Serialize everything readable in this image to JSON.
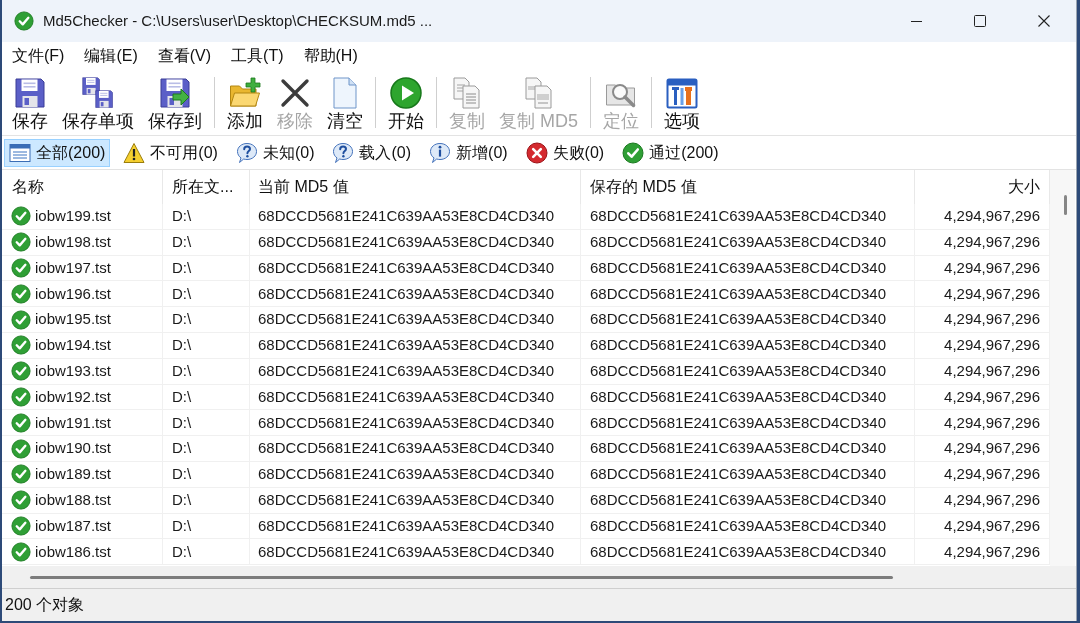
{
  "window": {
    "title": "Md5Checker - C:\\Users\\user\\Desktop\\CHECKSUM.md5 ..."
  },
  "menu": [
    "文件(F)",
    "编辑(E)",
    "查看(V)",
    "工具(T)",
    "帮助(H)"
  ],
  "toolbar": {
    "groups": [
      {
        "buttons": [
          {
            "label": "保存",
            "disabled": false
          },
          {
            "label": "保存单项",
            "disabled": false
          },
          {
            "label": "保存到",
            "disabled": false
          }
        ]
      },
      {
        "buttons": [
          {
            "label": "添加",
            "disabled": false
          },
          {
            "label": "移除",
            "disabled": true
          },
          {
            "label": "清空",
            "disabled": false
          }
        ]
      },
      {
        "buttons": [
          {
            "label": "开始",
            "disabled": false
          }
        ]
      },
      {
        "buttons": [
          {
            "label": "复制",
            "disabled": true
          },
          {
            "label": "复制 MD5",
            "disabled": true
          }
        ]
      },
      {
        "buttons": [
          {
            "label": "定位",
            "disabled": true
          }
        ]
      },
      {
        "buttons": [
          {
            "label": "选项",
            "disabled": false
          }
        ]
      }
    ]
  },
  "filters": [
    {
      "label": "全部(200)",
      "selected": true
    },
    {
      "label": "不可用(0)",
      "selected": false
    },
    {
      "label": "未知(0)",
      "selected": false
    },
    {
      "label": "载入(0)",
      "selected": false
    },
    {
      "label": "新增(0)",
      "selected": false
    },
    {
      "label": "失败(0)",
      "selected": false
    },
    {
      "label": "通过(200)",
      "selected": false
    }
  ],
  "table": {
    "columns": [
      "名称",
      "所在文...",
      "当前 MD5 值",
      "保存的 MD5 值",
      "大小"
    ],
    "rows": [
      {
        "passed": true,
        "name": "iobw199.tst",
        "folder": "D:\\",
        "current_md5": "68DCCD5681E241C639AA53E8CD4CD340",
        "saved_md5": "68DCCD5681E241C639AA53E8CD4CD340",
        "size": "4,294,967,296"
      },
      {
        "passed": true,
        "name": "iobw198.tst",
        "folder": "D:\\",
        "current_md5": "68DCCD5681E241C639AA53E8CD4CD340",
        "saved_md5": "68DCCD5681E241C639AA53E8CD4CD340",
        "size": "4,294,967,296"
      },
      {
        "passed": true,
        "name": "iobw197.tst",
        "folder": "D:\\",
        "current_md5": "68DCCD5681E241C639AA53E8CD4CD340",
        "saved_md5": "68DCCD5681E241C639AA53E8CD4CD340",
        "size": "4,294,967,296"
      },
      {
        "passed": true,
        "name": "iobw196.tst",
        "folder": "D:\\",
        "current_md5": "68DCCD5681E241C639AA53E8CD4CD340",
        "saved_md5": "68DCCD5681E241C639AA53E8CD4CD340",
        "size": "4,294,967,296"
      },
      {
        "passed": true,
        "name": "iobw195.tst",
        "folder": "D:\\",
        "current_md5": "68DCCD5681E241C639AA53E8CD4CD340",
        "saved_md5": "68DCCD5681E241C639AA53E8CD4CD340",
        "size": "4,294,967,296"
      },
      {
        "passed": true,
        "name": "iobw194.tst",
        "folder": "D:\\",
        "current_md5": "68DCCD5681E241C639AA53E8CD4CD340",
        "saved_md5": "68DCCD5681E241C639AA53E8CD4CD340",
        "size": "4,294,967,296"
      },
      {
        "passed": true,
        "name": "iobw193.tst",
        "folder": "D:\\",
        "current_md5": "68DCCD5681E241C639AA53E8CD4CD340",
        "saved_md5": "68DCCD5681E241C639AA53E8CD4CD340",
        "size": "4,294,967,296"
      },
      {
        "passed": true,
        "name": "iobw192.tst",
        "folder": "D:\\",
        "current_md5": "68DCCD5681E241C639AA53E8CD4CD340",
        "saved_md5": "68DCCD5681E241C639AA53E8CD4CD340",
        "size": "4,294,967,296"
      },
      {
        "passed": true,
        "name": "iobw191.tst",
        "folder": "D:\\",
        "current_md5": "68DCCD5681E241C639AA53E8CD4CD340",
        "saved_md5": "68DCCD5681E241C639AA53E8CD4CD340",
        "size": "4,294,967,296"
      },
      {
        "passed": true,
        "name": "iobw190.tst",
        "folder": "D:\\",
        "current_md5": "68DCCD5681E241C639AA53E8CD4CD340",
        "saved_md5": "68DCCD5681E241C639AA53E8CD4CD340",
        "size": "4,294,967,296"
      },
      {
        "passed": true,
        "name": "iobw189.tst",
        "folder": "D:\\",
        "current_md5": "68DCCD5681E241C639AA53E8CD4CD340",
        "saved_md5": "68DCCD5681E241C639AA53E8CD4CD340",
        "size": "4,294,967,296"
      },
      {
        "passed": true,
        "name": "iobw188.tst",
        "folder": "D:\\",
        "current_md5": "68DCCD5681E241C639AA53E8CD4CD340",
        "saved_md5": "68DCCD5681E241C639AA53E8CD4CD340",
        "size": "4,294,967,296"
      },
      {
        "passed": true,
        "name": "iobw187.tst",
        "folder": "D:\\",
        "current_md5": "68DCCD5681E241C639AA53E8CD4CD340",
        "saved_md5": "68DCCD5681E241C639AA53E8CD4CD340",
        "size": "4,294,967,296"
      },
      {
        "passed": true,
        "name": "iobw186.tst",
        "folder": "D:\\",
        "current_md5": "68DCCD5681E241C639AA53E8CD4CD340",
        "saved_md5": "68DCCD5681E241C639AA53E8CD4CD340",
        "size": "4,294,967,296"
      }
    ]
  },
  "status_bar": {
    "text": "200 个对象"
  }
}
